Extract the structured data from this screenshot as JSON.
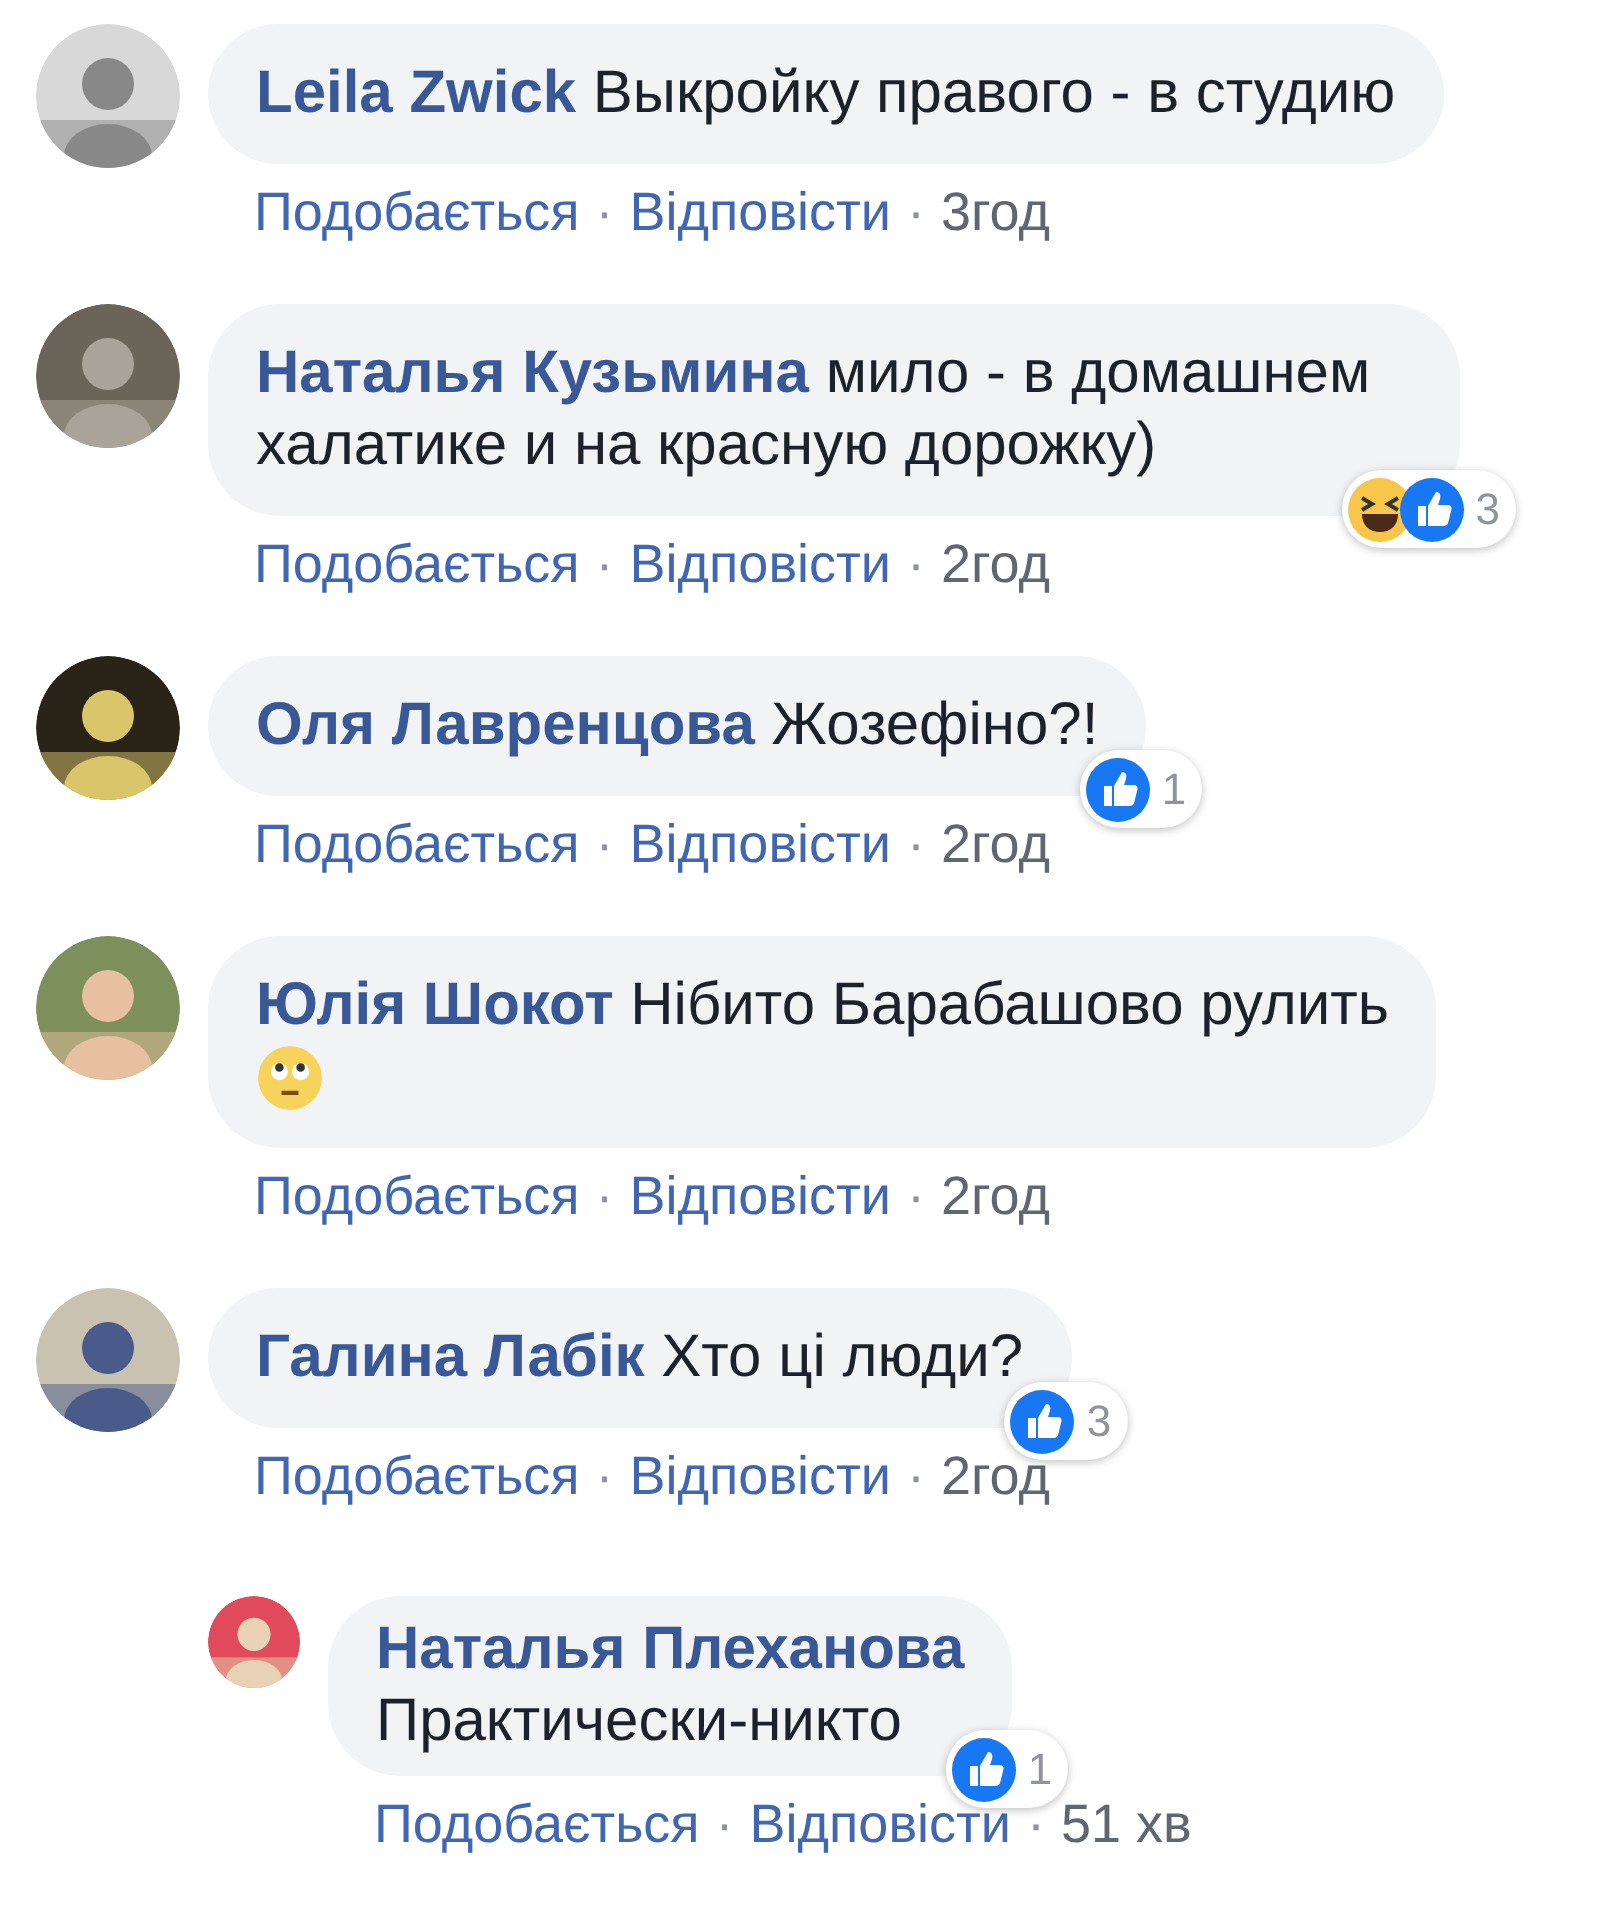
{
  "comments": [
    {
      "author": "Leila Zwick",
      "text": "Выкройку правого - в студию",
      "meta": [
        "Подобається",
        "·",
        "Відповісти",
        "·",
        "3год"
      ]
    },
    {
      "author": "Наталья Кузьмина",
      "text": "мило - в домашнем халатике и на красную дорожку)",
      "meta": [
        "Подобається",
        "·",
        "Відповісти",
        "·",
        "2год"
      ],
      "reactions": [
        {
          "kind": "haha"
        },
        {
          "kind": "like"
        }
      ],
      "count": "3"
    },
    {
      "author": "Оля Лавренцова",
      "text": "Жозефіно?!",
      "meta": [
        "Подобається",
        "·",
        "Відповісти",
        "·",
        "2год"
      ],
      "reactions": [
        {
          "kind": "like"
        }
      ],
      "count": "1"
    },
    {
      "author": "Юлія Шокот",
      "text": "Нібито Барабашово рулить",
      "emoji": true,
      "meta": [
        "Подобається",
        "·",
        "Відповісти",
        "·",
        "2год"
      ]
    },
    {
      "author": "Галина Лабік",
      "text": "Хто ці люди?",
      "meta": [
        "Подобається",
        "·",
        "Відповісти",
        "·",
        "2год"
      ],
      "reactions": [
        {
          "kind": "like"
        }
      ],
      "count": "3",
      "replies": [
        {
          "author": "Наталья Плеханова",
          "text": "Практически-никто",
          "meta": [
            "Подобається",
            "·",
            "Відповісти",
            "·",
            "51 хв"
          ],
          "reactions": [
            {
              "kind": "like"
            }
          ],
          "count": "1"
        }
      ]
    }
  ]
}
